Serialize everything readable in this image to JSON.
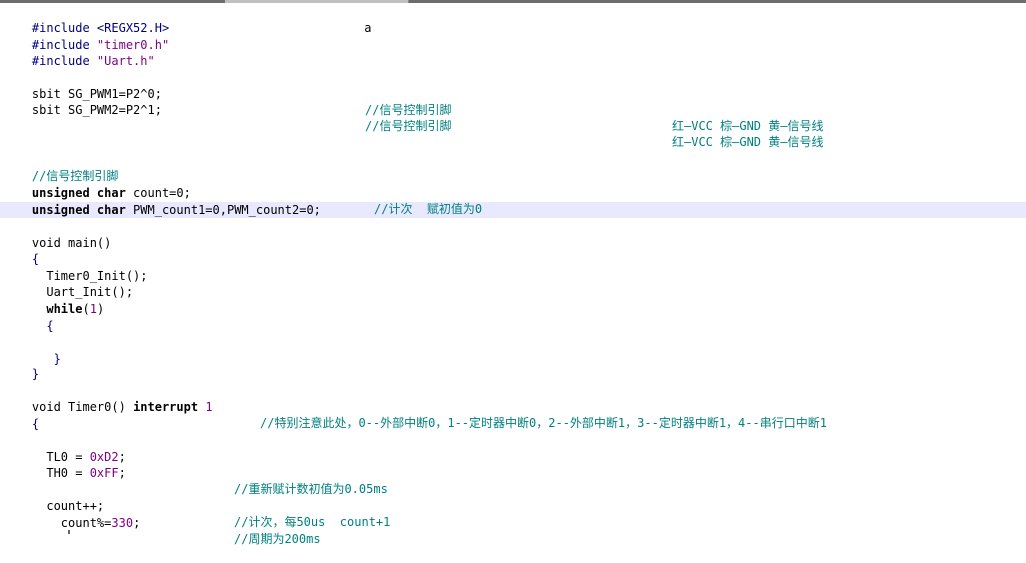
{
  "colors": {
    "background": "#ffffff",
    "current_line": "#e8e8ff",
    "comment": "#008080",
    "preprocessor": "#000080",
    "string": "#7f007f",
    "number": "#800080",
    "keyword": "#000000"
  },
  "code": {
    "l1": {
      "a": "#include",
      "b": " <REGX52.H>",
      "c": "                           a"
    },
    "l2": {
      "a": "#include",
      "b": " \"timer0.h\""
    },
    "l3": {
      "a": "#include",
      "b": " \"Uart.h\""
    },
    "l5": {
      "a": "sbit SG_PWM1=P2^0;",
      "c": "//信号控制引脚",
      "d": "红—VCC 棕—GND 黄—信号线"
    },
    "l6": {
      "a": "sbit SG_PWM2=P2^1;",
      "c": "//信号控制引脚",
      "d": "红—VCC 棕—GND 黄—信号线"
    },
    "l10": {
      "c": "//信号控制引脚"
    },
    "l11": {
      "k": "unsigned char",
      "a": " count=0;",
      "c": "//计次  赋初值为0"
    },
    "l12": {
      "k": "unsigned char",
      "a": " PWM_count1=0,PWM_count2=0;"
    },
    "l14": {
      "a": "void main()"
    },
    "l15": {
      "a": "{"
    },
    "l16": {
      "a": "  Timer0_Init();"
    },
    "l17": {
      "a": "  Uart_Init();"
    },
    "l18": {
      "k": "  while",
      "a": "(",
      "n": "1",
      "b": ")"
    },
    "l19": {
      "a": "  {"
    },
    "l21": {
      "a": "   }"
    },
    "l22": {
      "a": "}"
    },
    "l24": {
      "a": "void Timer0() ",
      "k": "interrupt",
      "n": " 1",
      "c": "//特别注意此处，0--外部中断0，1--定时器中断0，2--外部中断1，3--定时器中断1，4--串行口中断1"
    },
    "l25": {
      "a": "{"
    },
    "l27": {
      "a": "  TL0 = ",
      "n": "0xD2",
      "b": ";"
    },
    "l28": {
      "a": "  TH0 = ",
      "n": "0xFF",
      "b": ";",
      "c": "//重新赋计数初值为0.05ms"
    },
    "l30": {
      "a": "  count++;",
      "c": "//计次，每50us  count+1"
    },
    "l31": {
      "a": "    count%=",
      "n": "330",
      "b": ";",
      "c": "//周期为200ms"
    }
  }
}
